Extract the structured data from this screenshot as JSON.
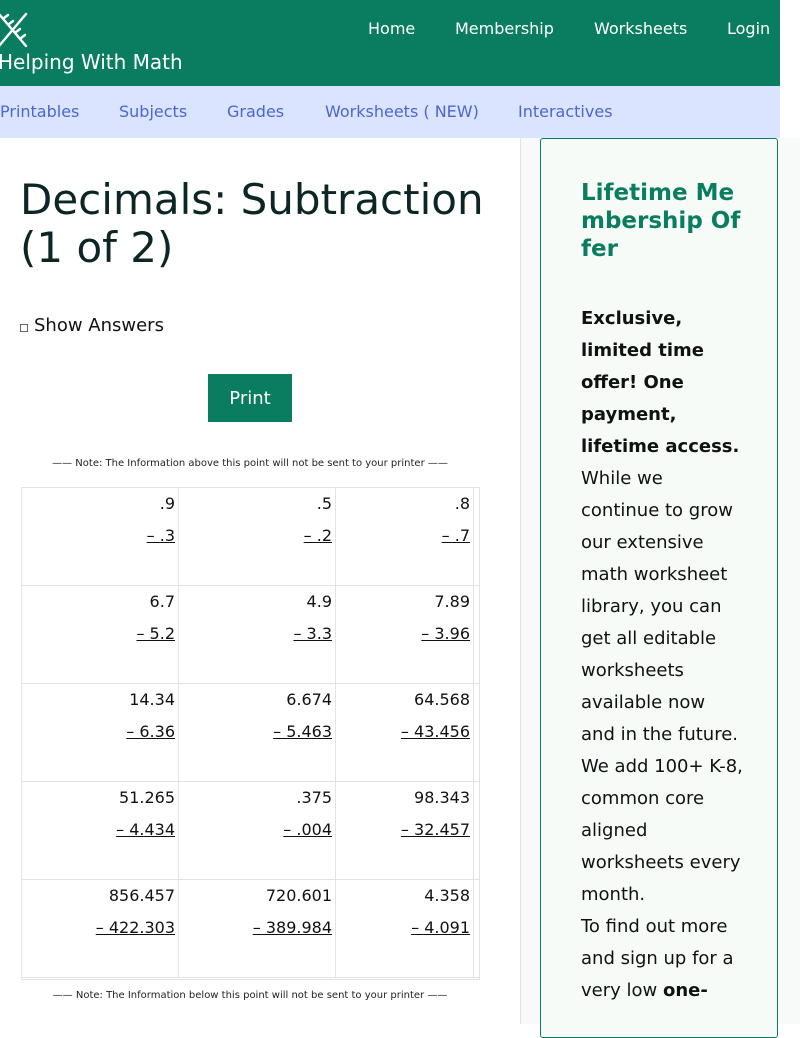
{
  "header": {
    "site_name": "Helping With Math",
    "nav": [
      {
        "label": "Home"
      },
      {
        "label": "Membership"
      },
      {
        "label": "Worksheets"
      },
      {
        "label": "Login"
      }
    ]
  },
  "subnav": {
    "items": [
      {
        "label": "Printables"
      },
      {
        "label": "Subjects"
      },
      {
        "label": "Grades"
      },
      {
        "label": "Worksheets ( NEW)"
      },
      {
        "label": "Interactives"
      }
    ]
  },
  "main": {
    "title": "Decimals: Subtraction (1 of 2)",
    "show_answers_label": "Show Answers",
    "print_label": "Print",
    "note_top": "—— Note: The Information above this point will not be sent to your printer ——",
    "note_bottom": "—— Note: The Information below this point will not be sent to your printer ——"
  },
  "worksheet": {
    "rows": [
      [
        {
          "top": ".9",
          "bottom": "– .3"
        },
        {
          "top": ".5",
          "bottom": "– .2"
        },
        {
          "top": ".8",
          "bottom": "– .7"
        }
      ],
      [
        {
          "top": "6.7",
          "bottom": "– 5.2"
        },
        {
          "top": "4.9",
          "bottom": "– 3.3"
        },
        {
          "top": "7.89",
          "bottom": "– 3.96"
        }
      ],
      [
        {
          "top": "14.34",
          "bottom": "– 6.36"
        },
        {
          "top": "6.674",
          "bottom": "– 5.463"
        },
        {
          "top": "64.568",
          "bottom": "– 43.456"
        }
      ],
      [
        {
          "top": "51.265",
          "bottom": "– 4.434"
        },
        {
          "top": ".375",
          "bottom": "– .004"
        },
        {
          "top": "98.343",
          "bottom": "– 32.457"
        }
      ],
      [
        {
          "top": "856.457",
          "bottom": "– 422.303"
        },
        {
          "top": "720.601",
          "bottom": "– 389.984"
        },
        {
          "top": "4.358",
          "bottom": "– 4.091"
        }
      ]
    ]
  },
  "promo": {
    "title": "Lifetime Membership Offer",
    "highlight": "Exclusive, limited time offer! One payment, lifetime access.",
    "body": "While we continue to grow our extensive math worksheet library, you can get all editable worksheets available now and in the future. We add 100+ K-8, common core aligned worksheets every month.",
    "cta_prefix": "To find out more and sign up for a very low",
    "cta_strong": "one-"
  },
  "colors": {
    "brand_green": "#0a7d61",
    "subnav_bg": "#dae4ff",
    "subnav_link": "#4b67cf"
  }
}
